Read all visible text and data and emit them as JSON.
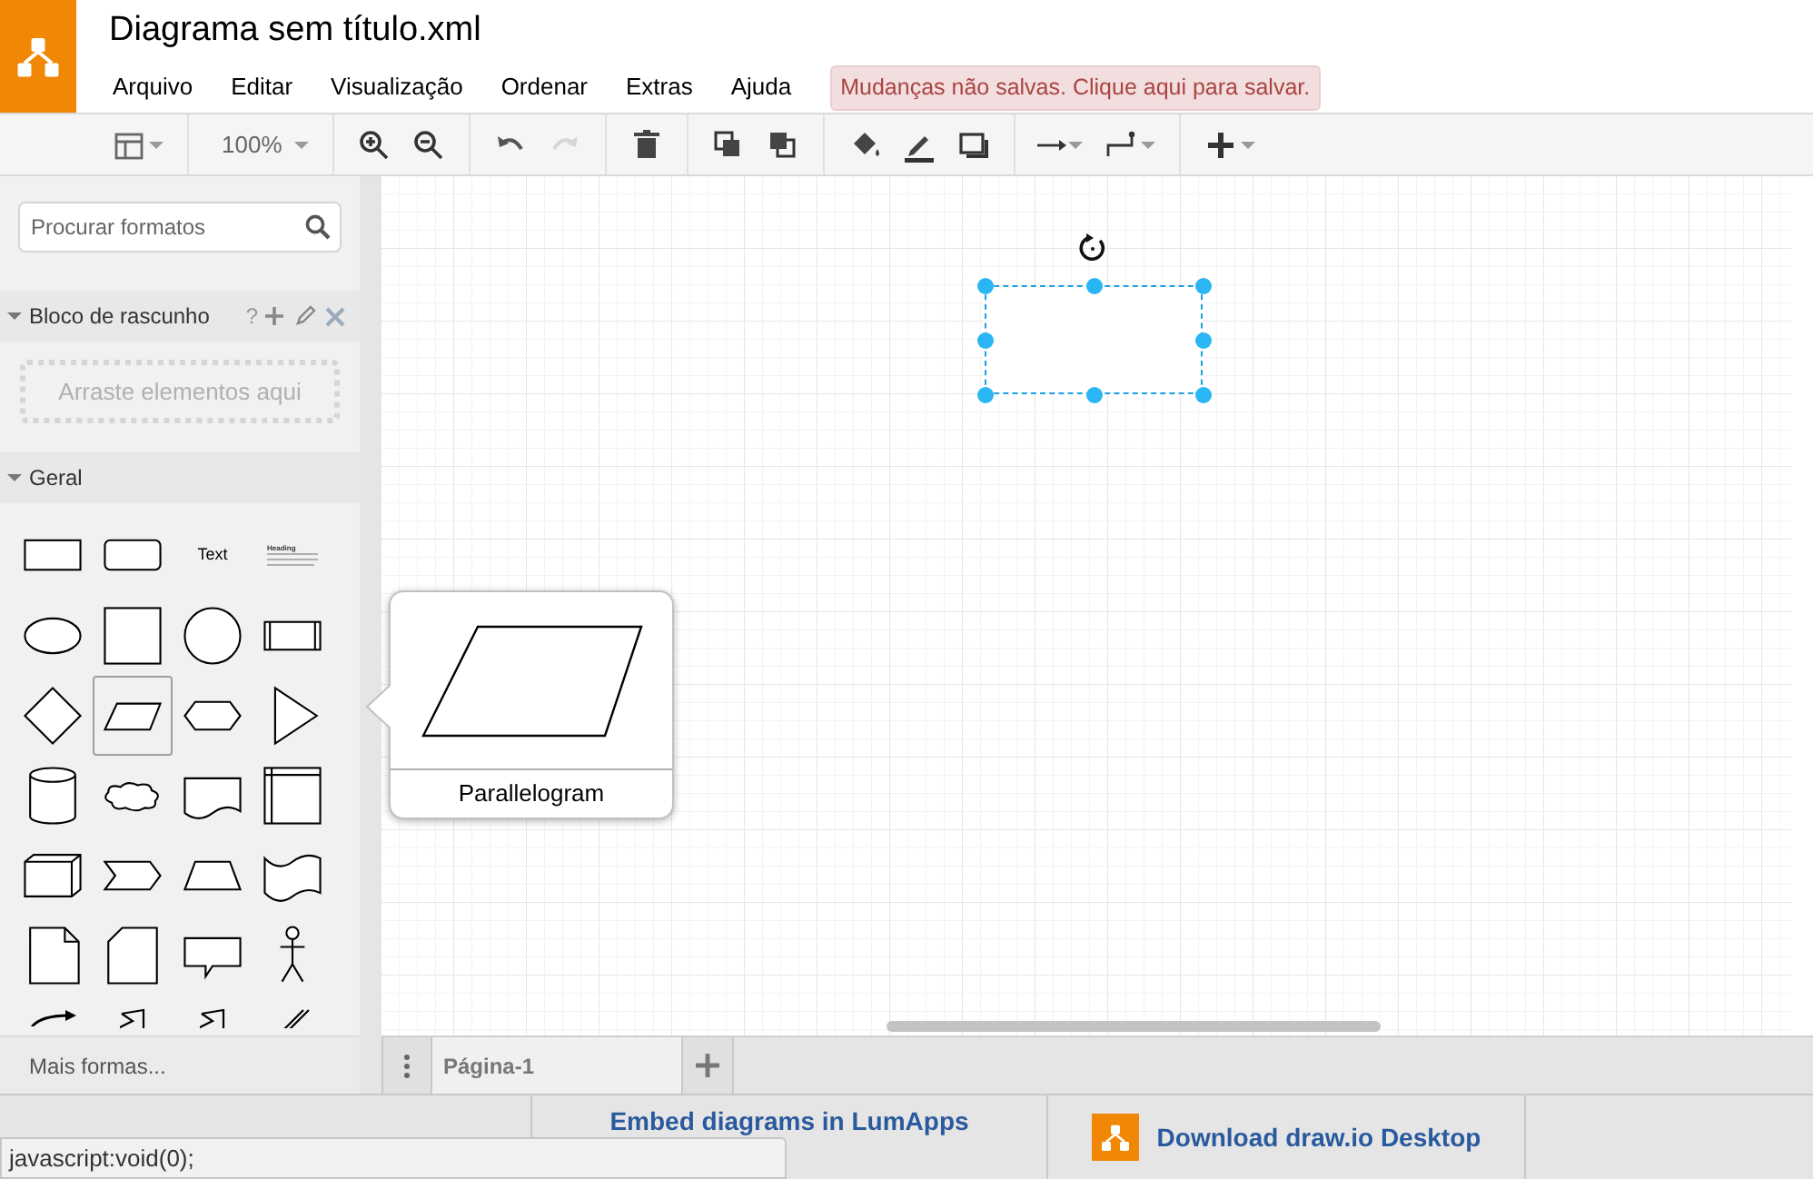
{
  "app": {
    "title": "Diagrama sem título.xml"
  },
  "menu": [
    "Arquivo",
    "Editar",
    "Visualização",
    "Ordenar",
    "Extras",
    "Ajuda"
  ],
  "save_notice": "Mudanças não salvas. Clique aqui para salvar.",
  "toolbar": [
    {
      "kind": "layout",
      "dropdown": true,
      "disabled": false
    },
    {
      "kind": "zoom",
      "label": "100%",
      "dropdown": true,
      "disabled": false
    },
    {
      "kind": "zoom-in",
      "dropdown": false,
      "disabled": false
    },
    {
      "kind": "zoom-out",
      "dropdown": false,
      "disabled": false
    },
    {
      "kind": "undo",
      "dropdown": false,
      "disabled": false
    },
    {
      "kind": "redo",
      "dropdown": false,
      "disabled": true
    },
    {
      "kind": "delete",
      "dropdown": false,
      "disabled": false
    },
    {
      "kind": "to-front",
      "dropdown": false,
      "disabled": false
    },
    {
      "kind": "to-back",
      "dropdown": false,
      "disabled": false
    },
    {
      "kind": "fill",
      "dropdown": false,
      "disabled": false
    },
    {
      "kind": "line",
      "dropdown": false,
      "disabled": false
    },
    {
      "kind": "shadow",
      "dropdown": false,
      "disabled": false
    },
    {
      "kind": "connection",
      "dropdown": true,
      "disabled": false
    },
    {
      "kind": "waypoints",
      "dropdown": true,
      "disabled": false
    },
    {
      "kind": "insert",
      "dropdown": true,
      "disabled": false
    }
  ],
  "sidebar": {
    "search": {
      "placeholder": "Procurar formatos"
    },
    "scratchpad": {
      "title": "Bloco de rascunho",
      "expanded": true,
      "help": "?",
      "drop_hint": "Arraste elementos aqui"
    },
    "general": {
      "title": "Geral",
      "expanded": true,
      "shapes": [
        {
          "kind": "rectangle",
          "selected": false
        },
        {
          "kind": "rounded-rectangle",
          "selected": false
        },
        {
          "kind": "text",
          "label": "Text",
          "selected": false
        },
        {
          "kind": "heading",
          "label": "Heading",
          "selected": false
        },
        {
          "kind": "ellipse",
          "selected": false
        },
        {
          "kind": "square",
          "selected": false
        },
        {
          "kind": "circle",
          "selected": false
        },
        {
          "kind": "process",
          "selected": false
        },
        {
          "kind": "diamond",
          "selected": false
        },
        {
          "kind": "parallelogram",
          "selected": true
        },
        {
          "kind": "hexagon",
          "selected": false
        },
        {
          "kind": "triangle",
          "selected": false
        },
        {
          "kind": "cylinder",
          "selected": false
        },
        {
          "kind": "cloud",
          "selected": false
        },
        {
          "kind": "document",
          "selected": false
        },
        {
          "kind": "internal-storage",
          "selected": false
        },
        {
          "kind": "cube",
          "selected": false
        },
        {
          "kind": "step",
          "selected": false
        },
        {
          "kind": "trapezoid",
          "selected": false
        },
        {
          "kind": "tape",
          "selected": false
        },
        {
          "kind": "note",
          "selected": false
        },
        {
          "kind": "card",
          "selected": false
        },
        {
          "kind": "callout",
          "selected": false
        },
        {
          "kind": "actor",
          "selected": false
        },
        {
          "kind": "curved-arrow",
          "selected": false
        },
        {
          "kind": "link",
          "selected": false
        },
        {
          "kind": "link",
          "selected": false
        },
        {
          "kind": "double-line",
          "selected": false
        }
      ]
    },
    "more_shapes": "Mais formas..."
  },
  "tooltip": {
    "label": "Parallelogram"
  },
  "canvas": {
    "shapes": [
      {
        "kind": "rectangle",
        "selected": true
      }
    ]
  },
  "pages": [
    {
      "label": "Página-1",
      "selected": true
    }
  ],
  "footer": [
    {
      "kind": "link",
      "label": "Embed diagrams in LumApps"
    },
    {
      "kind": "download",
      "label": "Download draw.io Desktop"
    }
  ],
  "status_bar": "javascript:void(0);"
}
